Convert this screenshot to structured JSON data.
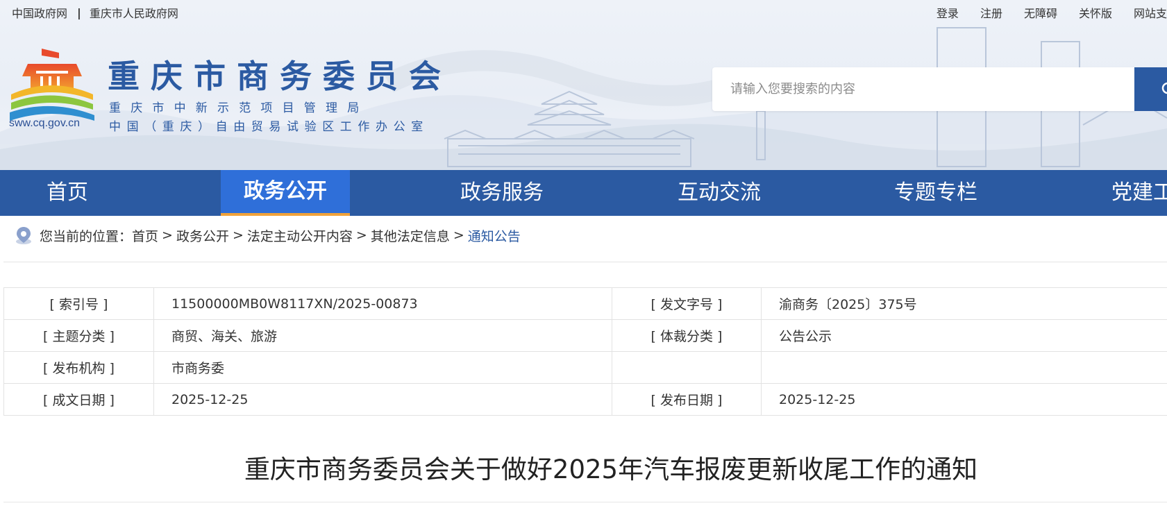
{
  "topbar": {
    "left_links": [
      "中国政府网",
      "重庆市人民政府网"
    ],
    "separator": "|",
    "right_links": [
      "登录",
      "注册",
      "无障碍",
      "关怀版",
      "网站支"
    ]
  },
  "logo": {
    "url_text": "sww.cq.gov.cn"
  },
  "site": {
    "title": "重庆市商务委员会",
    "subtitle_1": "重庆市中新示范项目管理局",
    "subtitle_2": "中国（重庆）自由贸易试验区工作办公室"
  },
  "search": {
    "placeholder": "请输入您要搜索的内容"
  },
  "nav": {
    "items": [
      "首页",
      "政务公开",
      "政务服务",
      "互动交流",
      "专题专栏",
      "党建工"
    ],
    "active_index": 1
  },
  "breadcrumb": {
    "prefix": "您当前的位置：",
    "items": [
      "首页",
      "政务公开",
      "法定主动公开内容",
      "其他法定信息",
      "通知公告"
    ],
    "separator": ">"
  },
  "info_table": {
    "rows": [
      [
        "[ 索引号 ]",
        "11500000MB0W8117XN/2025-00873",
        "[ 发文字号 ]",
        "渝商务〔2025〕375号"
      ],
      [
        "[ 主题分类 ]",
        "商贸、海关、旅游",
        "[ 体裁分类 ]",
        "公告公示"
      ],
      [
        "[ 发布机构 ]",
        "市商务委",
        "",
        ""
      ],
      [
        "[ 成文日期 ]",
        "2025-12-25",
        "[ 发布日期 ]",
        "2025-12-25"
      ]
    ]
  },
  "article": {
    "title": "重庆市商务委员会关于做好2025年汽车报废更新收尾工作的通知"
  },
  "colors": {
    "brand_blue": "#2b5aa2",
    "nav_active": "#2f6fd9",
    "nav_active_underline": "#f0a23a",
    "header_bg": "#eef2f8"
  },
  "icons": {
    "logo": "government-logo-icon",
    "search": "search-icon",
    "breadcrumb": "location-pin-icon"
  }
}
